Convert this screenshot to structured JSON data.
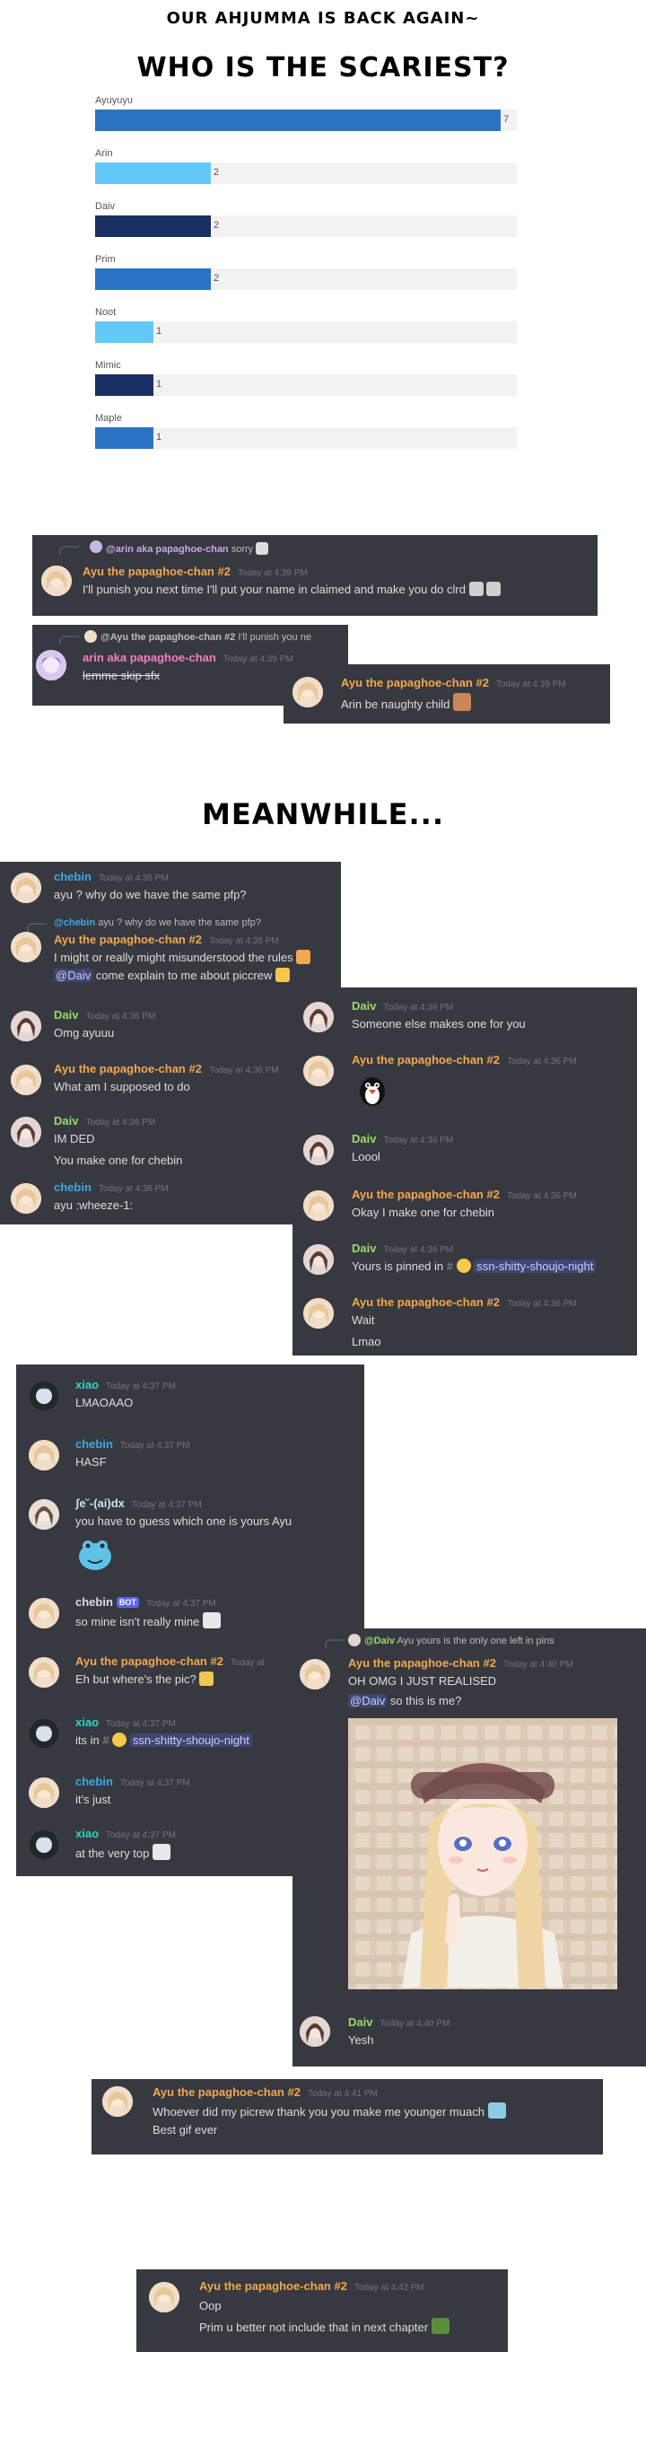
{
  "captions": {
    "top": "OUR AHJUMMA IS BACK AGAIN~",
    "headline": "WHO IS THE SCARIEST?",
    "meanwhile": "MEANWHILE..."
  },
  "chart_data": {
    "type": "bar",
    "orientation": "horizontal",
    "categories": [
      "Ayuyuyu",
      "Arin",
      "Daiv",
      "Prim",
      "Noot",
      "Mimic",
      "Maple"
    ],
    "values": [
      7,
      2,
      2,
      2,
      1,
      1,
      1
    ],
    "colors": [
      "#2b73c2",
      "#63c8f6",
      "#1a2f63",
      "#2b73c2",
      "#63c8f6",
      "#1a2f63",
      "#2b73c2"
    ],
    "xlim": [
      0,
      7
    ],
    "title": "",
    "xlabel": "",
    "ylabel": "",
    "legend": "none",
    "grid": false
  },
  "colors": {
    "ayu": "#f3a74f",
    "chebin": "#3fa7e8",
    "daiv": "#9bd96a",
    "xiao": "#2bd7c5",
    "arin": "#f47fbf",
    "panel_bg": "#36393f"
  },
  "chat1": {
    "reply_name": "@arin aka papaghoe-chan",
    "reply_text": "sorry",
    "author": "Ayu the papaghoe-chan #2",
    "time": "Today at 4:39 PM",
    "text": "I'll punish you next time I'll put your name in claimed and make you do clrd"
  },
  "chat2": {
    "reply_name": "@Ayu the papaghoe-chan #2",
    "reply_text": "I'll punish you ne",
    "author": "arin aka papaghoe-chan",
    "time": "Today at 4:39 PM",
    "text": "lemme skip sfx"
  },
  "chat3": {
    "author": "Ayu the papaghoe-chan #2",
    "time": "Today at 4:39 PM",
    "text": "Arin be naughty child"
  },
  "chat4": {
    "messages": [
      {
        "author": "chebin",
        "time": "Today at 4:35 PM",
        "lines": [
          "ayu ? why do we have the same pfp?"
        ]
      },
      {
        "reply_name": "@chebin",
        "reply_text": "ayu ? why do we have the same pfp?",
        "author": "Ayu the papaghoe-chan #2",
        "time": "Today at 4:35 PM",
        "lines": [
          "I might or really might misunderstood the rules"
        ],
        "mention": "@Daiv",
        "mention_text": "come explain to me about piccrew"
      },
      {
        "author": "Daiv",
        "time": "Today at 4:36 PM",
        "lines": [
          "Omg ayuuu"
        ]
      },
      {
        "author": "Ayu the papaghoe-chan #2",
        "time": "Today at 4:36 PM",
        "lines": [
          "What am I supposed to do"
        ]
      },
      {
        "author": "Daiv",
        "time": "Today at 4:36 PM",
        "lines": [
          "IM DED",
          "You make one for chebin"
        ]
      },
      {
        "author": "chebin",
        "time": "Today at 4:36 PM",
        "lines": [
          "ayu :wheeze-1:"
        ]
      }
    ]
  },
  "chat5": {
    "messages": [
      {
        "author": "Daiv",
        "time": "Today at 4:36 PM",
        "lines": [
          "Someone else makes one for you"
        ]
      },
      {
        "author": "Ayu the papaghoe-chan #2",
        "time": "Today at 4:36 PM",
        "lines": []
      },
      {
        "author": "Daiv",
        "time": "Today at 4:36 PM",
        "lines": [
          "Loool"
        ]
      },
      {
        "author": "Ayu the papaghoe-chan #2",
        "time": "Today at 4:36 PM",
        "lines": [
          "Okay I make one for chebin"
        ]
      },
      {
        "author": "Daiv",
        "time": "Today at 4:36 PM",
        "lines": [
          "Yours is pinned in"
        ],
        "channel": "ssn-shitty-shoujo-night"
      },
      {
        "author": "Ayu the papaghoe-chan #2",
        "time": "Today at 4:36 PM",
        "lines": [
          "Wait",
          "Lmao"
        ]
      }
    ]
  },
  "chat6": {
    "messages": [
      {
        "author": "xiao",
        "time": "Today at 4:37 PM",
        "lines": [
          "LMAOAAO"
        ]
      },
      {
        "author": "chebin",
        "time": "Today at 4:37 PM",
        "lines": [
          "HASF"
        ]
      },
      {
        "author": "ʃe˘-(ai)dx",
        "time": "Today at 4:37 PM",
        "lines": [
          "you have to guess which one is yours Ayu"
        ]
      },
      {
        "author": "chebin",
        "bot": "BOT",
        "time": "Today at 4:37 PM",
        "lines": [
          "so mine isn't really mine"
        ]
      },
      {
        "author": "Ayu the papaghoe-chan #2",
        "time": "Today at",
        "lines": [
          "Eh but where's the pic?"
        ]
      },
      {
        "author": "xiao",
        "time": "Today at 4:37 PM",
        "lines": [
          "its in"
        ],
        "channel": "ssn-shitty-shoujo-night"
      },
      {
        "author": "chebin",
        "time": "Today at 4:37 PM",
        "lines": [
          "it's just"
        ]
      },
      {
        "author": "xiao",
        "time": "Today at 4:37 PM",
        "lines": [
          "at the very top"
        ]
      }
    ]
  },
  "chat7": {
    "reply_name": "@Daiv",
    "reply_text": "Ayu yours is the only one left in pins",
    "author": "Ayu the papaghoe-chan #2",
    "time": "Today at 4:40 PM",
    "line1": "OH OMG I JUST REALISED",
    "mention": "@Daiv",
    "line2": "so this is me?",
    "author2": "Daiv",
    "time2": "Today at 4:40 PM",
    "line3": "Yesh"
  },
  "chat8": {
    "author": "Ayu the papaghoe-chan #2",
    "time": "Today at 4:41 PM",
    "line1": "Whoever did my picrew thank you you make me younger muach",
    "line2": "Best gif ever"
  },
  "chat9": {
    "author": "Ayu the papaghoe-chan #2",
    "time": "Today at 4:42 PM",
    "line1": "Oop",
    "line2": "Prim u better not include that in next chapter"
  }
}
